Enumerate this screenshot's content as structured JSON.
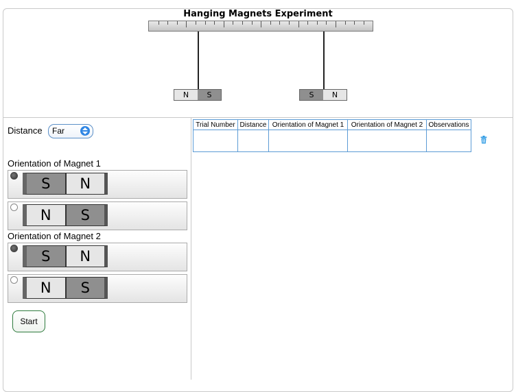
{
  "title": "Hanging Magnets Experiment",
  "hanging_magnets": {
    "left": {
      "left_pole": "N",
      "right_pole": "S"
    },
    "right": {
      "left_pole": "S",
      "right_pole": "N"
    }
  },
  "controls": {
    "distance_label": "Distance",
    "distance_value": "Far",
    "magnet1_label": "Orientation of Magnet 1",
    "magnet2_label": "Orientation of Magnet 2",
    "magnet1_options": [
      {
        "left": "S",
        "right": "N",
        "selected": true
      },
      {
        "left": "N",
        "right": "S",
        "selected": false
      }
    ],
    "magnet2_options": [
      {
        "left": "S",
        "right": "N",
        "selected": true
      },
      {
        "left": "N",
        "right": "S",
        "selected": false
      }
    ],
    "start_label": "Start"
  },
  "table": {
    "headers": [
      "Trial Number",
      "Distance",
      "Orientation of Magnet 1",
      "Orientation of Magnet 2",
      "Observations"
    ]
  },
  "colors": {
    "accent": "#2f86e4",
    "table_border": "#5b9bd5",
    "start_border": "#2d7a3c"
  }
}
